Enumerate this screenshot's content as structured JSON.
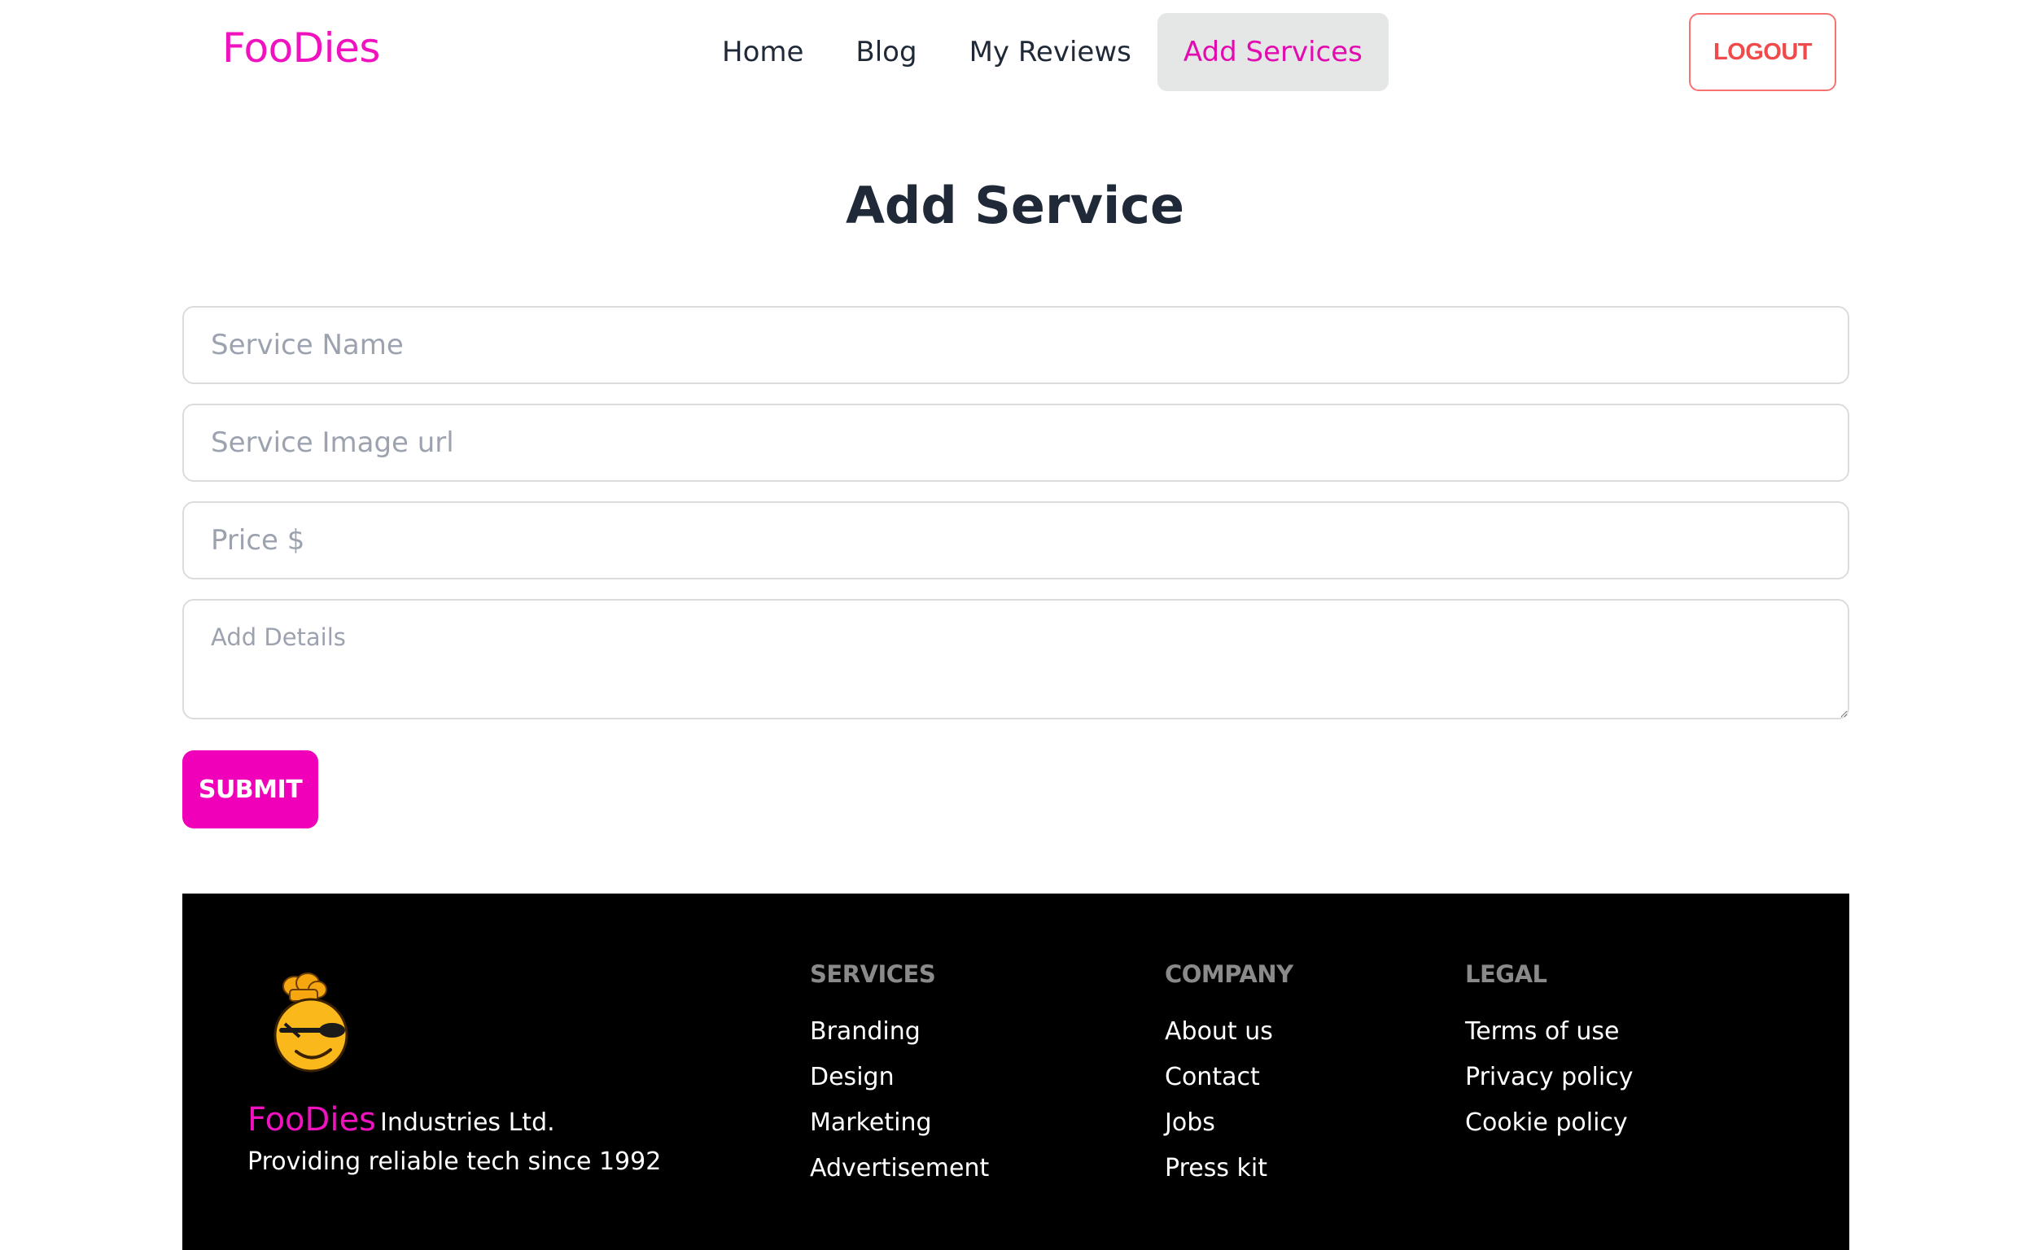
{
  "navbar": {
    "brand": "FooDies",
    "menu": [
      {
        "label": "Home"
      },
      {
        "label": "Blog"
      },
      {
        "label": "My Reviews"
      },
      {
        "label": "Add Services"
      }
    ],
    "active_item": "Add Services",
    "logout_label": "LOGOUT"
  },
  "form": {
    "title": "Add Service",
    "service_name_placeholder": "Service Name",
    "service_image_placeholder": "Service Image url",
    "price_placeholder": "Price $",
    "details_placeholder": "Add Details",
    "submit_label": "SUBMIT"
  },
  "footer": {
    "company_name": "FooDies",
    "company_suffix": "Industries Ltd.",
    "tagline": "Providing reliable tech since 1992",
    "columns": [
      {
        "title": "SERVICES",
        "links": [
          "Branding",
          "Design",
          "Marketing",
          "Advertisement"
        ]
      },
      {
        "title": "COMPANY",
        "links": [
          "About us",
          "Contact",
          "Jobs",
          "Press kit"
        ]
      },
      {
        "title": "LEGAL",
        "links": [
          "Terms of use",
          "Privacy policy",
          "Cookie policy"
        ]
      }
    ]
  },
  "colors": {
    "brand_pink": "#f012be",
    "submit_bg": "#f000b8",
    "logout_red": "#f04a4a",
    "active_nav_bg": "#e5e6e6",
    "footer_bg": "#000000",
    "footer_heading": "#8a8a8a"
  },
  "icons": {
    "footer_logo": "chef-mascot-logo"
  }
}
